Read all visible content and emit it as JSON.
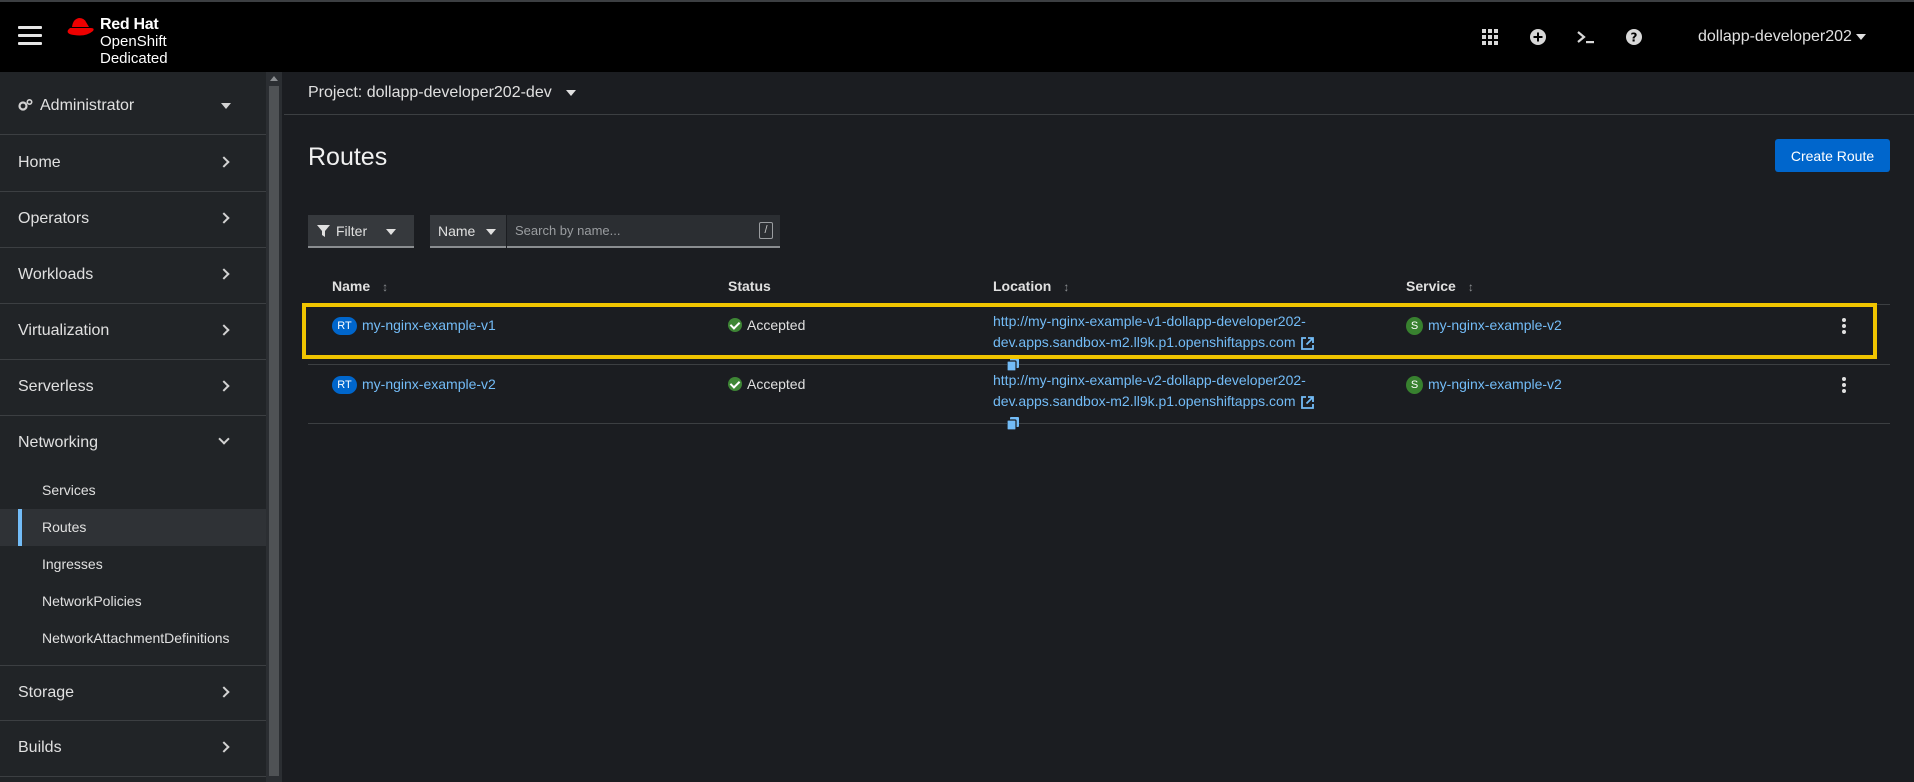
{
  "masthead": {
    "brand_line1": "Red Hat",
    "brand_line2": "OpenShift",
    "brand_line3": "Dedicated",
    "icons": [
      "apps-grid-icon",
      "plus-circle-icon",
      "terminal-icon",
      "help-icon"
    ],
    "user": "dollapp-developer202"
  },
  "sidebar": {
    "perspective": "Administrator",
    "sections": [
      {
        "label": "Home",
        "expanded": false
      },
      {
        "label": "Operators",
        "expanded": false
      },
      {
        "label": "Workloads",
        "expanded": false
      },
      {
        "label": "Virtualization",
        "expanded": false
      },
      {
        "label": "Serverless",
        "expanded": false
      },
      {
        "label": "Networking",
        "expanded": true
      },
      {
        "label": "Storage",
        "expanded": false
      },
      {
        "label": "Builds",
        "expanded": false
      }
    ],
    "networking_items": [
      {
        "label": "Services"
      },
      {
        "label": "Routes",
        "active": true
      },
      {
        "label": "Ingresses"
      },
      {
        "label": "NetworkPolicies"
      },
      {
        "label": "NetworkAttachmentDefinitions"
      }
    ]
  },
  "project": {
    "label": "Project: dollapp-developer202-dev"
  },
  "page": {
    "title": "Routes",
    "create_button": "Create Route"
  },
  "toolbar": {
    "filter_label": "Filter",
    "name_select": "Name",
    "search_placeholder": "Search by name...",
    "search_shortcut": "/"
  },
  "table": {
    "columns": [
      "Name",
      "Status",
      "Location",
      "Service"
    ],
    "rows": [
      {
        "badge": "RT",
        "name": "my-nginx-example-v1",
        "status": "Accepted",
        "location_line1": "http://my-nginx-example-v1-dollapp-developer202-",
        "location_line2": "dev.apps.sandbox-m2.ll9k.p1.openshiftapps.com",
        "service_badge": "S",
        "service": "my-nginx-example-v2",
        "highlighted": true
      },
      {
        "badge": "RT",
        "name": "my-nginx-example-v2",
        "status": "Accepted",
        "location_line1": "http://my-nginx-example-v2-dollapp-developer202-",
        "location_line2": "dev.apps.sandbox-m2.ll9k.p1.openshiftapps.com",
        "service_badge": "S",
        "service": "my-nginx-example-v2",
        "highlighted": false
      }
    ]
  },
  "colors": {
    "highlight": "#f0c400",
    "primary": "#0066cc",
    "link": "#73bcf7",
    "success": "#3e8635"
  }
}
